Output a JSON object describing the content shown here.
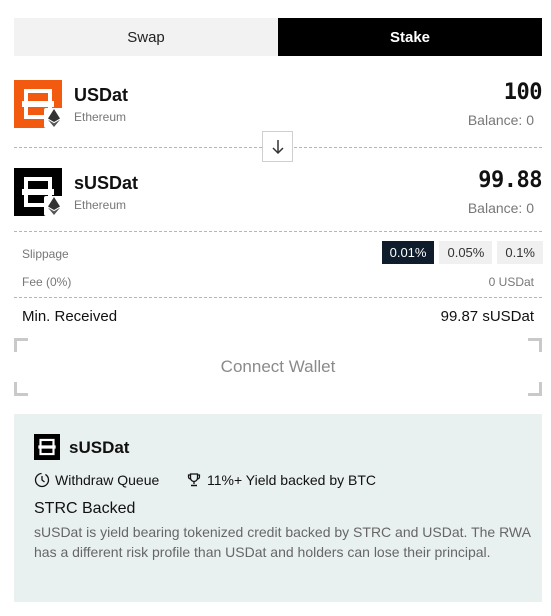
{
  "tabs": {
    "swap": "Swap",
    "stake": "Stake"
  },
  "from_token": {
    "name": "USDat",
    "chain": "Ethereum",
    "amount": "100",
    "balance": "Balance: 0",
    "icon": "usdat-logo-icon",
    "color": "#f25a0f"
  },
  "to_token": {
    "name": "sUSDat",
    "chain": "Ethereum",
    "amount": "99.88",
    "balance": "Balance: 0",
    "icon": "susdat-logo-icon",
    "color": "#000000"
  },
  "swap_direction_icon": "arrow-down-icon",
  "slippage": {
    "label": "Slippage",
    "options": [
      "0.01%",
      "0.05%",
      "0.1%"
    ],
    "selected": "0.01%"
  },
  "fee": {
    "label": "Fee (0%)",
    "value": "0 USDat"
  },
  "min_received": {
    "label": "Min. Received",
    "value": "99.87 sUSDat"
  },
  "connect_wallet": "Connect Wallet",
  "info_card": {
    "title": "sUSDat",
    "feature_1": "Withdraw Queue",
    "feature_2": "11%+ Yield backed by BTC",
    "subtitle": "STRC Backed",
    "description": "sUSDat is yield bearing tokenized credit backed by STRC and USDat. The RWA has a different risk profile than USDat and holders can lose their principal."
  }
}
